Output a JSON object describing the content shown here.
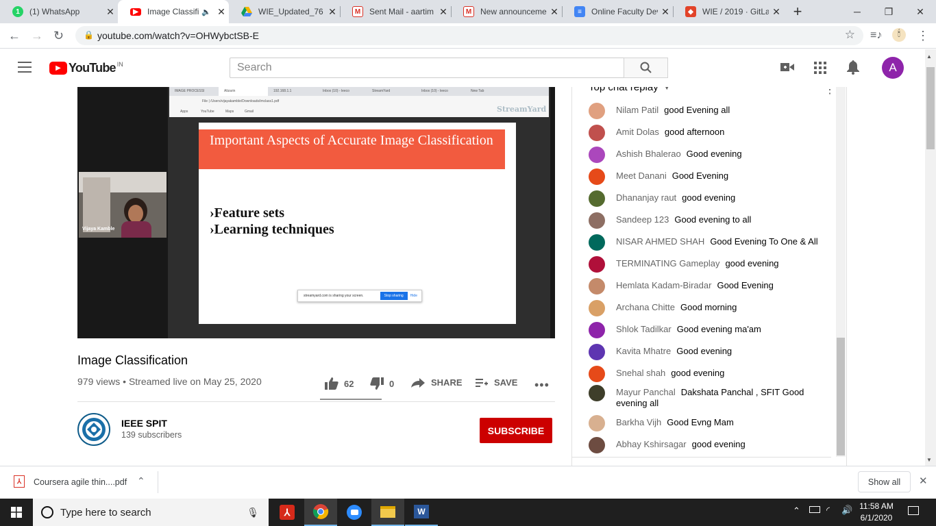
{
  "browser": {
    "tabs": [
      {
        "title": "(1) WhatsApp",
        "favicon": "whatsapp-icon",
        "color": "#25d366"
      },
      {
        "title": "Image Classifi",
        "favicon": "youtube-icon",
        "color": "#ff0000",
        "active": true
      },
      {
        "title": "WIE_Updated_76",
        "favicon": "google-drive-icon",
        "color": "#f4b400"
      },
      {
        "title": "Sent Mail - aartim",
        "favicon": "gmail-icon",
        "color": "#d93025"
      },
      {
        "title": "New announceme",
        "favicon": "gmail-icon",
        "color": "#d93025"
      },
      {
        "title": "Online Faculty Dev",
        "favicon": "google-forms-icon",
        "color": "#4285f4"
      },
      {
        "title": "WIE / 2019 · GitLal",
        "favicon": "gitlab-icon",
        "color": "#e24329"
      }
    ],
    "new_tab": "+",
    "url": "youtube.com/watch?v=OHWybctSB-E"
  },
  "youtube": {
    "logo_text": "YouTube",
    "region": "IN",
    "search_placeholder": "Search",
    "account_initial": "A",
    "account_color": "#8e24aa"
  },
  "video": {
    "title": "Image Classification",
    "views": "979 views",
    "streamed": "Streamed live on May 25, 2020",
    "likes": "62",
    "dislikes": "0",
    "share_label": "SHARE",
    "save_label": "SAVE",
    "slide": {
      "heading": "Important Aspects of Accurate Image Classification",
      "bullets": [
        "Feature sets",
        "Learning techniques"
      ],
      "banner": "streamyard.com is sharing your screen.",
      "stop_label": "Stop sharing",
      "hide_label": "Hide",
      "watermark": "StreamYard",
      "presenter_name": "Vijaya Kamble",
      "inner_url": "File | /Users/vijayakamble/Downloads/imclass1.pdf",
      "inner_tabs": [
        "IMAGE PROCESSI",
        "Alizarin",
        "192.168.1.1",
        "Inbox (10) - leeco",
        "StreamYard",
        "Inbox (10) - leeco",
        "New Tab"
      ],
      "inner_bookmarks": [
        "Apps",
        "YouTube",
        "Maps",
        "Gmail"
      ]
    }
  },
  "channel": {
    "name": "IEEE SPIT",
    "subscribers": "139 subscribers",
    "subscribe_label": "SUBSCRIBE"
  },
  "chat": {
    "header": "Top chat replay",
    "messages": [
      {
        "author": "Nilam Patil",
        "text": "good Evening all",
        "color": "#e0a080"
      },
      {
        "author": "Amit Dolas",
        "text": "good afternoon",
        "color": "#c0504d"
      },
      {
        "author": "Ashish Bhalerao",
        "text": "Good evening",
        "color": "#ab47bc"
      },
      {
        "author": "Meet Danani",
        "text": "Good Evening",
        "color": "#e64a19"
      },
      {
        "author": "Dhananjay raut",
        "text": "good evening",
        "color": "#556b2f"
      },
      {
        "author": "Sandeep 123",
        "text": "Good evening to all",
        "color": "#8d6e63"
      },
      {
        "author": "NISAR AHMED SHAH",
        "text": "Good Evening To One & All",
        "color": "#00695c"
      },
      {
        "author": "TERMINATING Gameplay",
        "text": "good evening",
        "color": "#b0103a"
      },
      {
        "author": "Hemlata Kadam-Biradar",
        "text": "Good Evening",
        "color": "#c48a6a"
      },
      {
        "author": "Archana Chitte",
        "text": "Good morning",
        "color": "#d9a066"
      },
      {
        "author": "Shlok Tadilkar",
        "text": "Good evening ma'am",
        "color": "#8e24aa"
      },
      {
        "author": "Kavita Mhatre",
        "text": "Good evening",
        "color": "#5e35b1"
      },
      {
        "author": "Snehal shah",
        "text": "good evening",
        "color": "#e64a19"
      },
      {
        "author": "Mayur Panchal",
        "text": "Dakshata Panchal , SFIT Good evening all",
        "color": "#3e3e2a"
      },
      {
        "author": "Barkha Vijh",
        "text": "Good Evng Mam",
        "color": "#d8b090"
      },
      {
        "author": "Abhay Kshirsagar",
        "text": "good evening",
        "color": "#6d4c41"
      }
    ]
  },
  "downloads": {
    "file": "Coursera agile thin....pdf",
    "show_all": "Show all"
  },
  "taskbar": {
    "search_placeholder": "Type here to search",
    "time": "11:58 AM",
    "date": "6/1/2020"
  }
}
